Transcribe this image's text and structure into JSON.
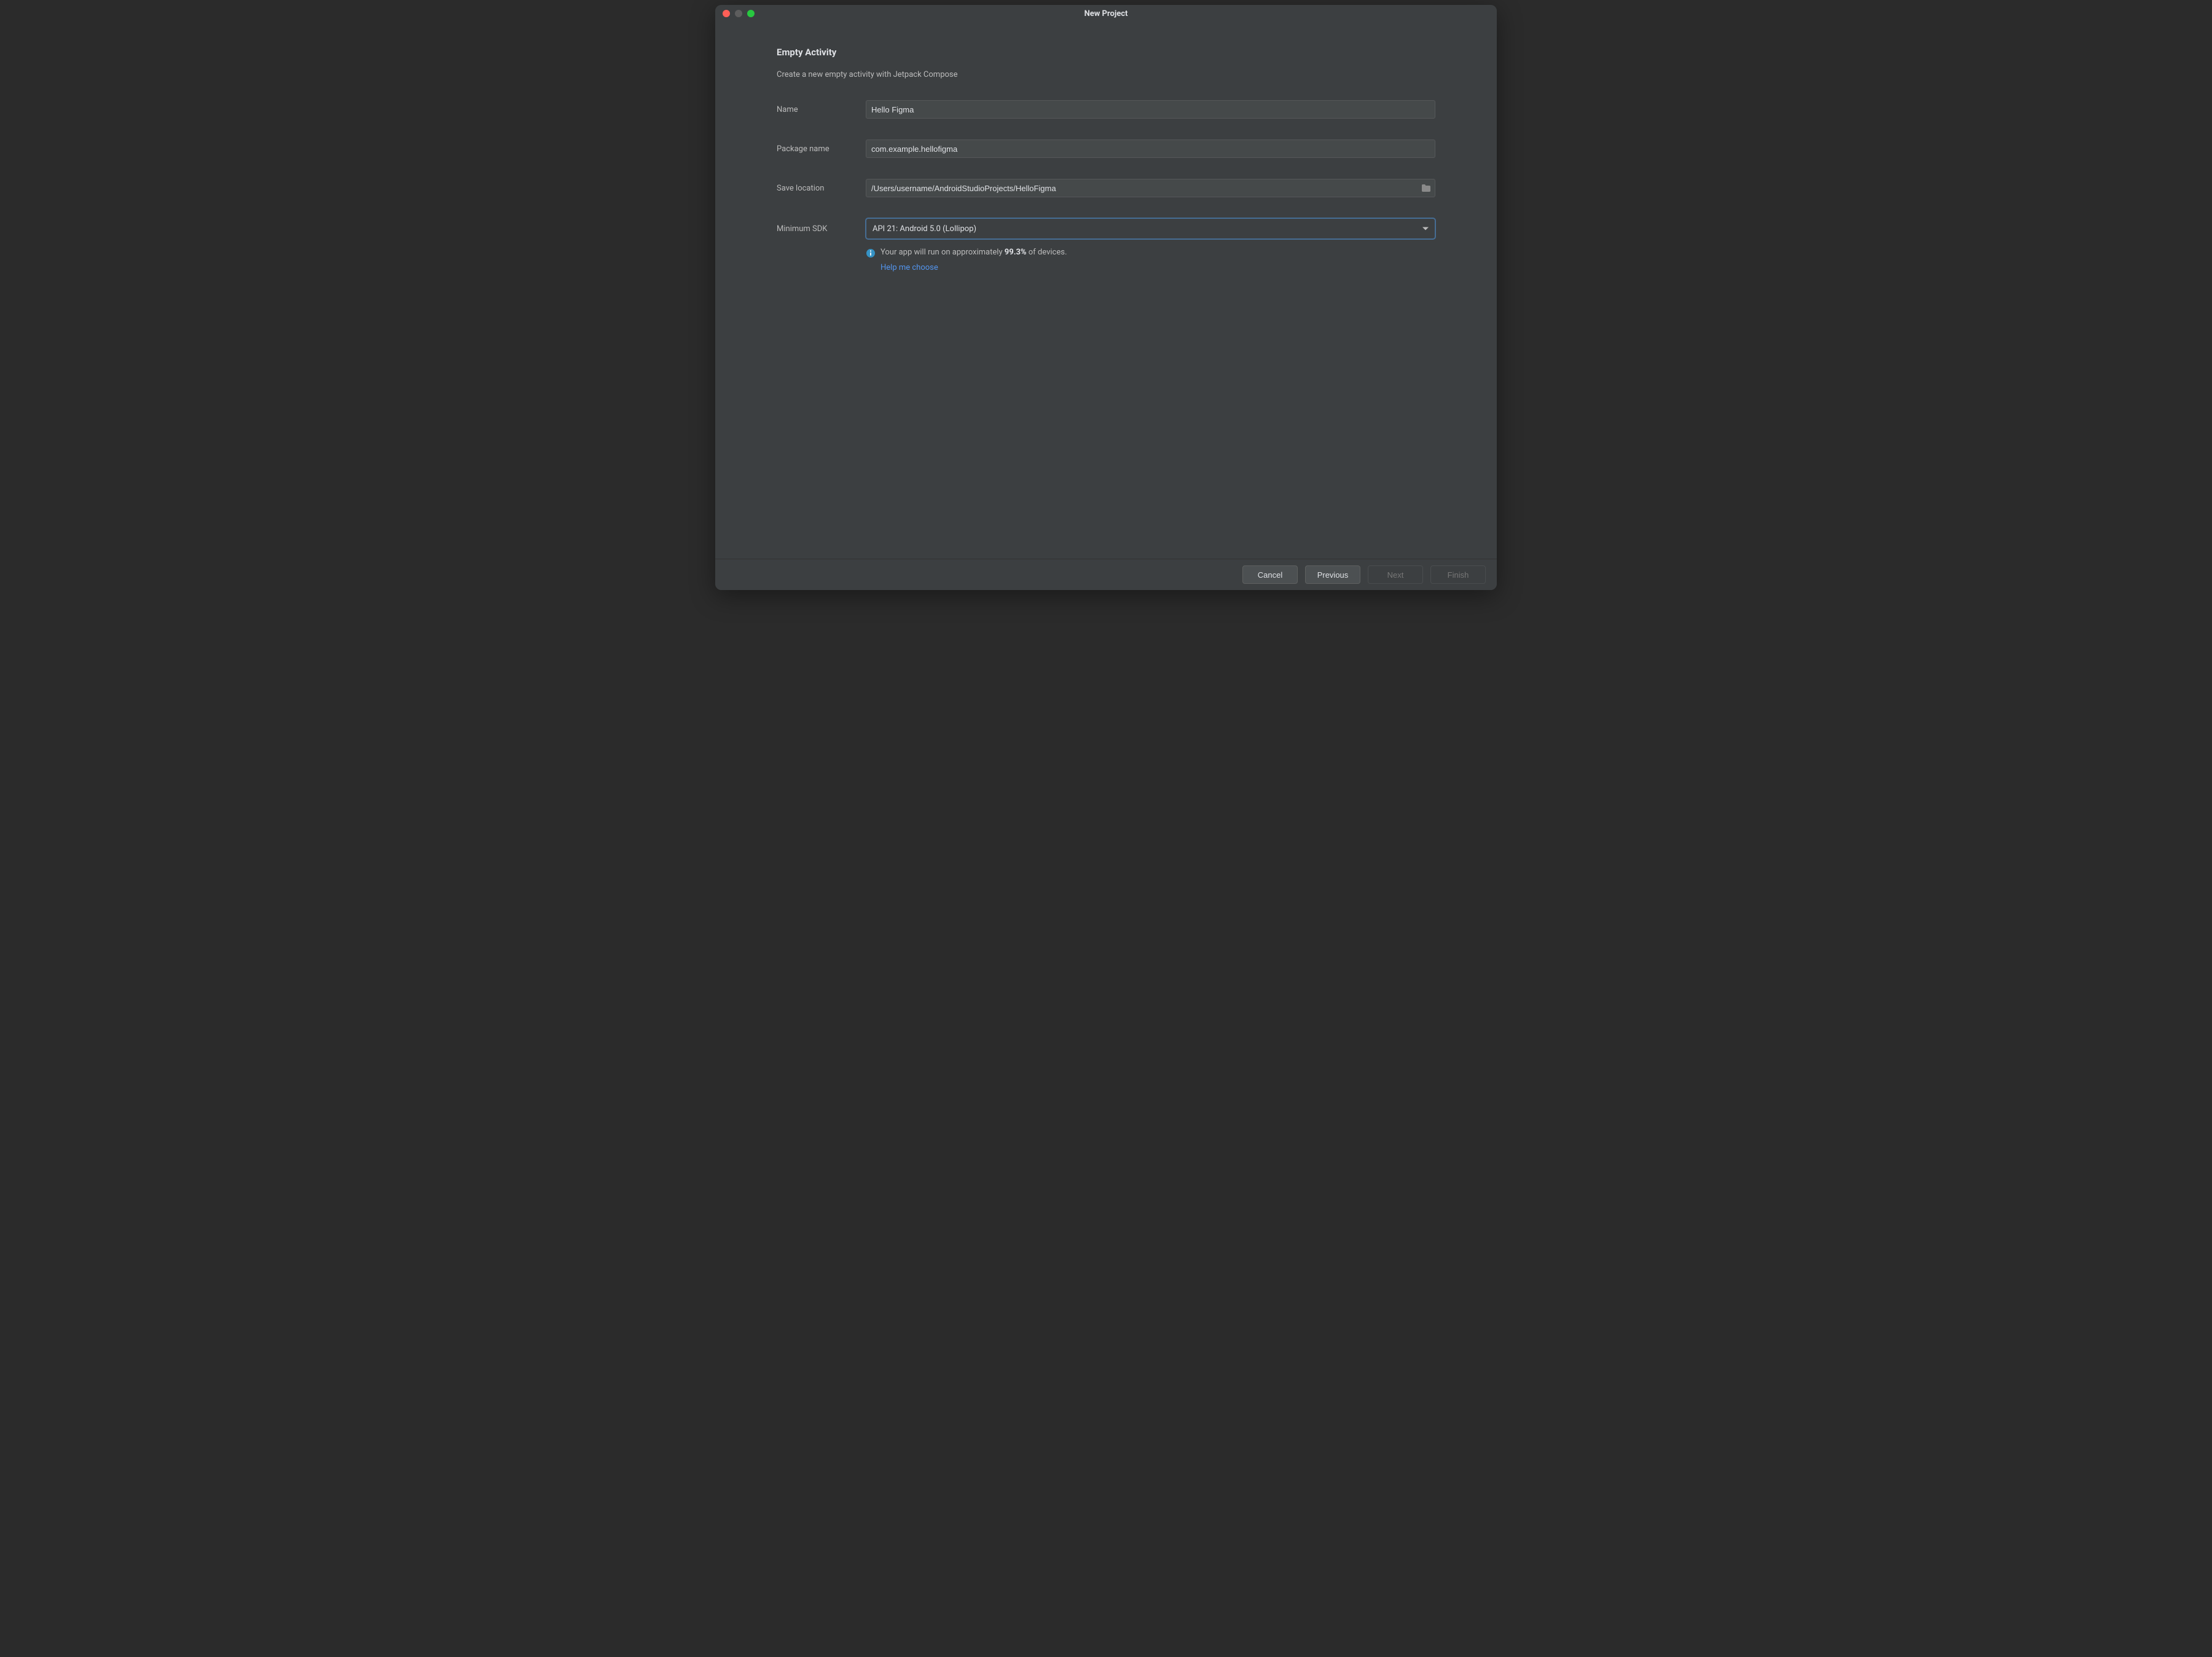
{
  "window": {
    "title": "New Project"
  },
  "header": {
    "heading": "Empty Activity",
    "subtitle": "Create a new empty activity with Jetpack Compose"
  },
  "form": {
    "name_label": "Name",
    "name_value": "Hello Figma",
    "package_label": "Package name",
    "package_value": "com.example.hellofigma",
    "location_label": "Save location",
    "location_value": "/Users/username/AndroidStudioProjects/HelloFigma",
    "sdk_label": "Minimum SDK",
    "sdk_value": "API 21: Android 5.0 (Lollipop)",
    "sdk_info_prefix": "Your app will run on approximately ",
    "sdk_info_percent": "99.3%",
    "sdk_info_suffix": " of devices.",
    "help_link": "Help me choose"
  },
  "footer": {
    "cancel": "Cancel",
    "previous": "Previous",
    "next": "Next",
    "finish": "Finish"
  }
}
